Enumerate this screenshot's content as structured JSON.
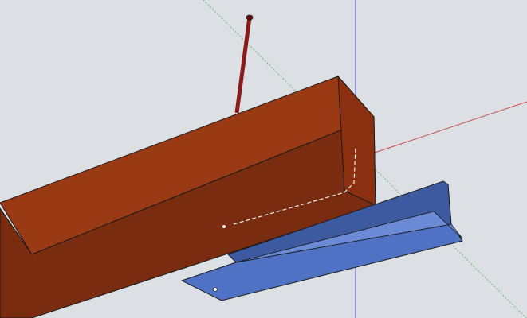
{
  "viewport": {
    "background": "#dcdfe3"
  },
  "colors": {
    "axis_red": "#c8403a",
    "axis_green": "#4caf50",
    "axis_blue": "#3a3ad6",
    "beam_front": "#7a2c10",
    "beam_top": "#9a3a14",
    "beam_end": "#8a3010",
    "bracket_blue": "#4f72c4",
    "bracket_dark": "#3d5aa0",
    "bracket_light": "#6b8bd6",
    "rod_red": "#8b1a1a",
    "edge": "#1a1a1a",
    "highlight": "#f2f2f2"
  },
  "scene_objects": [
    {
      "name": "wood-beam",
      "material": "wood"
    },
    {
      "name": "steel-bracket",
      "material": "metal"
    },
    {
      "name": "threaded-rod",
      "material": "steel"
    }
  ]
}
